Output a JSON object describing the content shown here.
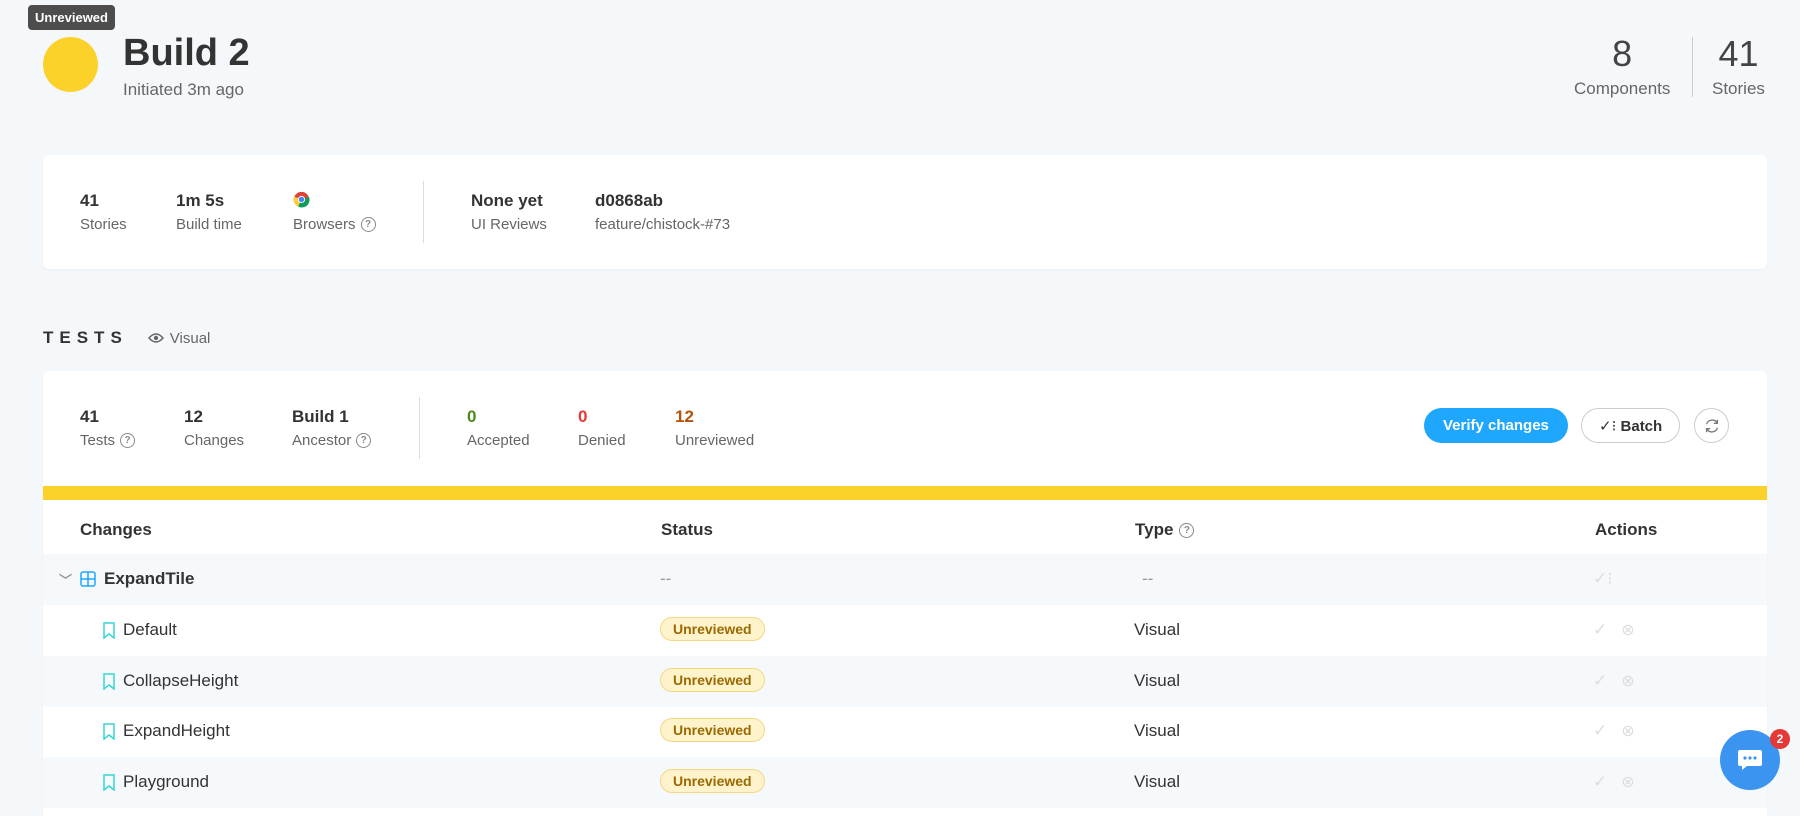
{
  "header": {
    "tooltip": "Unreviewed",
    "title": "Build 2",
    "subtitle": "Initiated 3m ago",
    "components_count": "8",
    "components_label": "Components",
    "stories_count": "41",
    "stories_label": "Stories"
  },
  "info": {
    "stories_value": "41",
    "stories_label": "Stories",
    "build_time_value": "1m 5s",
    "build_time_label": "Build time",
    "browsers_label": "Browsers",
    "reviews_value": "None yet",
    "reviews_label": "UI Reviews",
    "commit": "d0868ab",
    "branch": "feature/chistock-#73"
  },
  "tests": {
    "title": "TESTS",
    "mode": "Visual",
    "tests_value": "41",
    "tests_label": "Tests",
    "changes_value": "12",
    "changes_label": "Changes",
    "ancestor_value": "Build 1",
    "ancestor_label": "Ancestor",
    "accepted_value": "0",
    "accepted_label": "Accepted",
    "denied_value": "0",
    "denied_label": "Denied",
    "unreviewed_value": "12",
    "unreviewed_label": "Unreviewed",
    "verify_button": "Verify changes",
    "batch_button": "Batch"
  },
  "table": {
    "headers": {
      "changes": "Changes",
      "status": "Status",
      "type": "Type",
      "actions": "Actions"
    },
    "group": {
      "name": "ExpandTile",
      "status": "--",
      "type": "--"
    },
    "rows": [
      {
        "name": "Default",
        "status": "Unreviewed",
        "type": "Visual"
      },
      {
        "name": "CollapseHeight",
        "status": "Unreviewed",
        "type": "Visual"
      },
      {
        "name": "ExpandHeight",
        "status": "Unreviewed",
        "type": "Visual"
      },
      {
        "name": "Playground",
        "status": "Unreviewed",
        "type": "Visual"
      }
    ]
  },
  "chat": {
    "badge": "2"
  },
  "colors": {
    "accent": "#1ea7fd",
    "pending": "#fcd12a",
    "accepted": "#4a8b19",
    "denied": "#e53935",
    "unreviewed": "#b45309"
  }
}
